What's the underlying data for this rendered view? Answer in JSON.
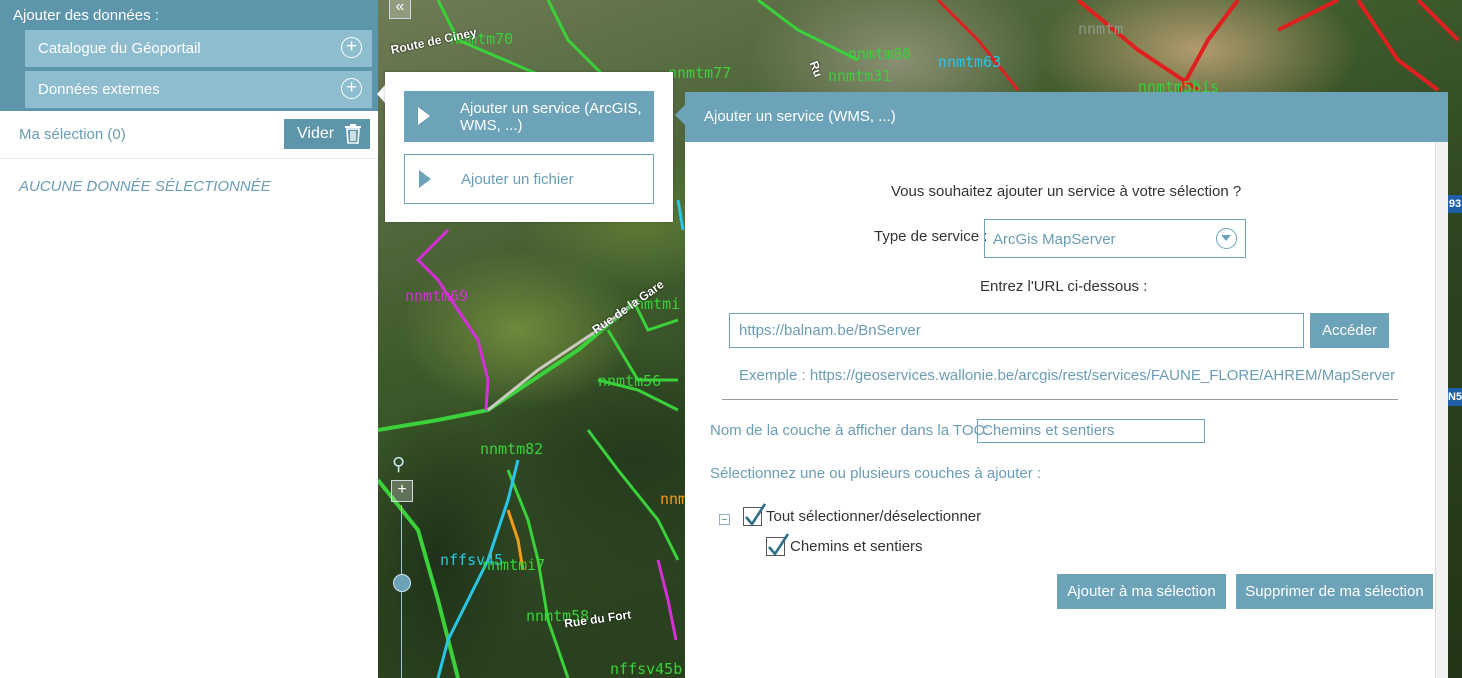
{
  "left_panel": {
    "title": "Ajouter des données :",
    "items": [
      {
        "label": "Catalogue du Géoportail",
        "icon": "plus-circle-icon"
      },
      {
        "label": "Données externes",
        "icon": "plus-circle-icon"
      }
    ],
    "selection_label": "Ma sélection (0)",
    "clear_label": "Vider",
    "empty_label": "AUCUNE DONNÉE SÉLECTIONNÉE"
  },
  "popover": {
    "service_label": "Ajouter un service (ArcGIS, WMS, ...)",
    "file_label": "Ajouter un fichier"
  },
  "dialog": {
    "title": "Ajouter un service (WMS, ...)",
    "question": "Vous souhaitez ajouter un service à votre sélection ?",
    "service_type_label": "Type de service :",
    "service_type_value": "ArcGis MapServer",
    "url_prompt": "Entrez l'URL ci-dessous :",
    "url_value": "https://balnam.be/BnServer",
    "go_label": "Accéder",
    "example": "Exemple : https://geoservices.wallonie.be/arcgis/rest/services/FAUNE_FLORE/AHREM/MapServer",
    "toc_label": "Nom de la couche à afficher dans la TOC:",
    "toc_value": "Chemins et sentiers",
    "layers_prompt": "Sélectionnez une ou plusieurs couches à ajouter :",
    "select_all_label": "Tout sélectionner/déselectionner",
    "select_all_checked": true,
    "layers": [
      {
        "label": "Chemins et sentiers",
        "checked": true
      }
    ],
    "add_label": "Ajouter à ma sélection",
    "remove_label": "Supprimer de ma sélection"
  },
  "map": {
    "labels": [
      "nnmtm70",
      "nnmtm77",
      "nnmtm80",
      "nnmtm31",
      "nnmtm63",
      "nnmtm5bis",
      "nnmtm",
      "nnmtm69",
      "nnmtmi",
      "nnmtm56",
      "nnmtm82",
      "nffsv45",
      "nnmtmi7",
      "nnmtm58",
      "nffsv45b",
      "nnm"
    ],
    "roads": [
      "Route de Ciney",
      "Rue de la Gare",
      "Ru",
      "Rue du Fort"
    ],
    "edge_badges": [
      "93",
      "N5"
    ],
    "colors": {
      "green": "#3ad13a",
      "cyan": "#29c6e8",
      "magenta": "#d530d8",
      "red": "#e0201e",
      "orange": "#f29a1a"
    }
  }
}
